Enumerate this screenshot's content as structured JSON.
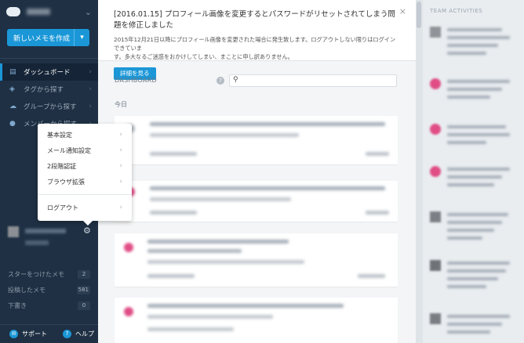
{
  "sidebar": {
    "new_memo_label": "新しいメモを作成",
    "nav": [
      {
        "label": "ダッシュボード",
        "icon": "document-icon"
      },
      {
        "label": "タグから探す",
        "icon": "tag-icon"
      },
      {
        "label": "グループから探す",
        "icon": "group-icon"
      },
      {
        "label": "メンバーから探す",
        "icon": "member-icon"
      }
    ],
    "stats": [
      {
        "label": "スターをつけたメモ",
        "count": "2"
      },
      {
        "label": "投稿したメモ",
        "count": "581"
      },
      {
        "label": "下書き",
        "count": "0"
      }
    ],
    "support_label": "サポート",
    "help_label": "ヘルプ"
  },
  "user_menu": {
    "items": [
      "基本設定",
      "メール通知設定",
      "2段階認証",
      "ブラウザ拡張"
    ],
    "logout_label": "ログアウト"
  },
  "notice": {
    "title": "[2016.01.15] プロフィール画像を変更するとパスワードがリセットされてしまう問題を修正しました",
    "body_line1": "2015年12月21日以降にプロフィール画像を変更された場合に発生致します。ログアウトしない限りはログインできていま",
    "body_line2": "す。多大なるご迷惑をおかけしてしまい、まことに申し訳ありません。",
    "button_label": "詳細を見る",
    "close_glyph": "×"
  },
  "dashboard": {
    "label": "DASHBOARD",
    "search_placeholder": "",
    "today_label": "今日"
  },
  "activities": {
    "title": "TEAM ACTIVITIES"
  },
  "colors": {
    "sidebar_bg": "#1f3044",
    "accent": "#1b97d7"
  }
}
